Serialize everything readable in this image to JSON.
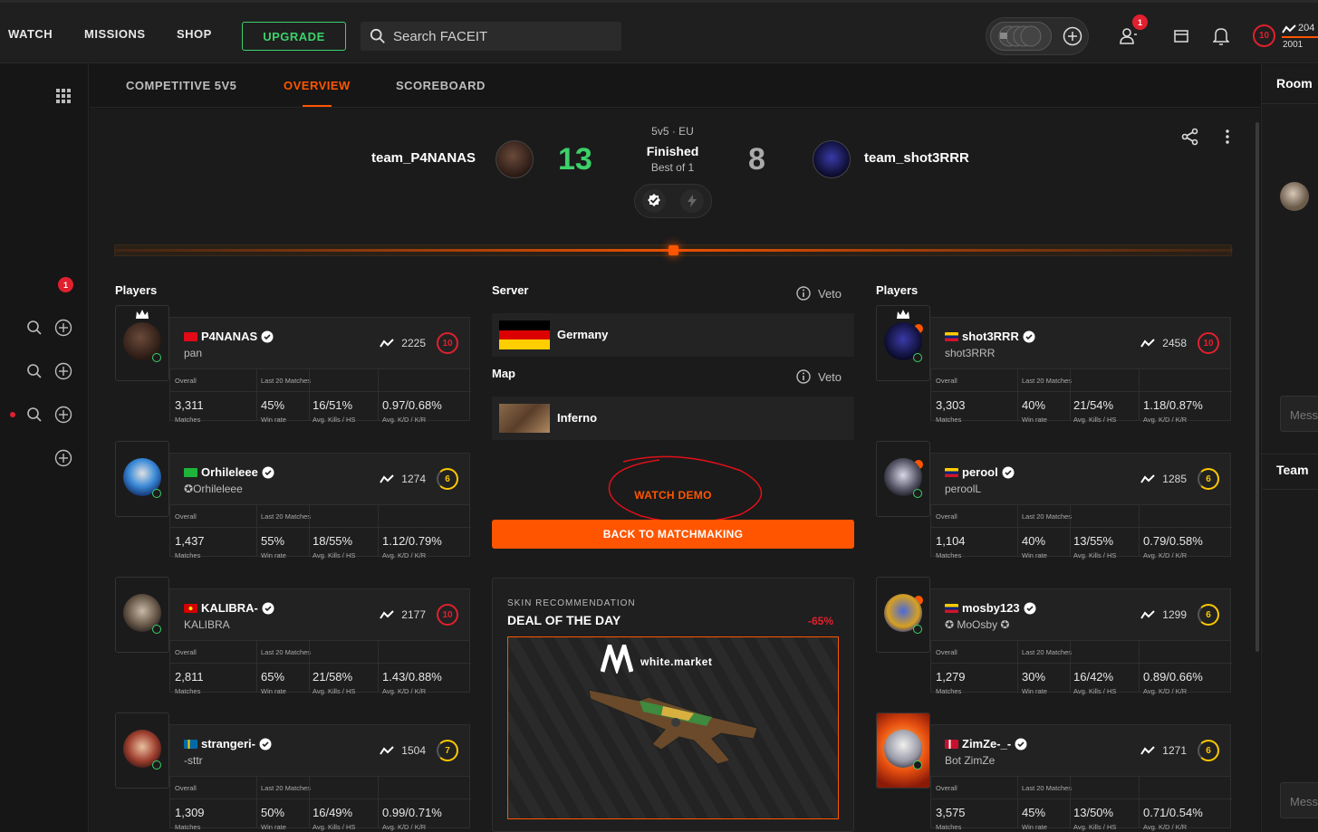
{
  "topnav": {
    "items": [
      "WATCH",
      "MISSIONS",
      "SHOP"
    ],
    "upgrade_label": "UPGRADE",
    "search_placeholder": "Search FACEIT",
    "friends_badge": "1",
    "user_level": "10",
    "user_elo_top": "204",
    "user_elo_sub": "2001"
  },
  "leftrail": {
    "notification_badge": "1"
  },
  "subtabs": [
    "COMPETITIVE 5V5",
    "OVERVIEW",
    "SCOREBOARD"
  ],
  "match": {
    "team_left": "team_P4NANAS",
    "team_right": "team_shot3RRR",
    "score_left": "13",
    "score_right": "8",
    "mode": "5v5 · EU",
    "status": "Finished",
    "format": "Best of 1",
    "progress": 0.5
  },
  "labels": {
    "players": "Players",
    "server": "Server",
    "map": "Map",
    "veto": "Veto",
    "overall": "Overall",
    "last20": "Last 20 Matches",
    "matches": "Matches",
    "winrate": "Win rate",
    "kills_hs": "Avg. Kills / HS",
    "kd_kr": "Avg. K/D / K/R"
  },
  "server": "Germany",
  "map": "Inferno",
  "actions": {
    "watch_demo": "WATCH DEMO",
    "back": "BACK TO MATCHMAKING"
  },
  "ad": {
    "kicker": "SKIN RECOMMENDATION",
    "title": "DEAL OF THE DAY",
    "discount": "-65%",
    "brand": "white.market"
  },
  "team_left_players": [
    {
      "name": "P4NANAS",
      "nick": "pan",
      "elo": "2225",
      "level": "10",
      "matches": "3,311",
      "winrate": "45%",
      "kills_hs": "16/51%",
      "kd_kr": "0.97/0.68%",
      "flag": "tr"
    },
    {
      "name": "Orhileleee",
      "nick": "Orhileleee",
      "elo": "1274",
      "level": "6",
      "matches": "1,437",
      "winrate": "55%",
      "kills_hs": "18/55%",
      "kd_kr": "1.12/0.79%",
      "flag": "tm"
    },
    {
      "name": "KALIBRA-",
      "nick": "KALIBRA",
      "elo": "2177",
      "level": "10",
      "matches": "2,811",
      "winrate": "65%",
      "kills_hs": "21/58%",
      "kd_kr": "1.43/0.88%",
      "flag": "mk"
    },
    {
      "name": "strangeri-",
      "nick": "-sttr",
      "elo": "1504",
      "level": "7",
      "matches": "1,309",
      "winrate": "50%",
      "kills_hs": "16/49%",
      "kd_kr": "0.99/0.71%",
      "flag": "se"
    }
  ],
  "team_right_players": [
    {
      "name": "shot3RRR",
      "nick": "shot3RRR",
      "elo": "2458",
      "level": "10",
      "matches": "3,303",
      "winrate": "40%",
      "kills_hs": "21/54%",
      "kd_kr": "1.18/0.87%",
      "flag": "ve"
    },
    {
      "name": "perool",
      "nick": "peroolL",
      "elo": "1285",
      "level": "6",
      "matches": "1,104",
      "winrate": "40%",
      "kills_hs": "13/55%",
      "kd_kr": "0.79/0.58%",
      "flag": "ve"
    },
    {
      "name": "mosby123",
      "nick": "MoOsby",
      "elo": "1299",
      "level": "6",
      "matches": "1,279",
      "winrate": "30%",
      "kills_hs": "16/42%",
      "kd_kr": "0.89/0.66%",
      "flag": "ve"
    },
    {
      "name": "ZimZe-_-",
      "nick": "Bot ZimZe",
      "elo": "1271",
      "level": "6",
      "matches": "3,575",
      "winrate": "45%",
      "kills_hs": "13/50%",
      "kd_kr": "0.71/0.54%",
      "flag": "dk"
    }
  ],
  "rightpanel": {
    "room_label": "Room",
    "team_label": "Team",
    "message_placeholder": "Mess"
  },
  "colors": {
    "accent": "#ff5500",
    "win": "#3cd16a",
    "level10": "#e0202e",
    "level_mid": "#ffc800"
  }
}
